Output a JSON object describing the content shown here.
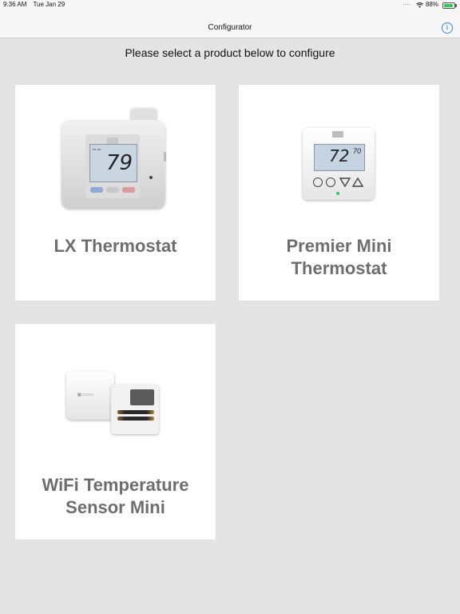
{
  "status_bar": {
    "time": "9:36 AM",
    "date": "Tue Jan 29",
    "battery": "88%",
    "battery_level": 0.88,
    "icons": [
      "signal-dots-icon",
      "wifi-icon",
      "battery-icon"
    ]
  },
  "nav": {
    "title": "Configurator",
    "info_icon": "info-icon"
  },
  "instruction": "Please select a product below to configure",
  "products": [
    {
      "label_line1": "LX Thermostat",
      "label_line2": "",
      "image": "lx-thermostat-image",
      "screen_temp": "79"
    },
    {
      "label_line1": "Premier Mini",
      "label_line2": "Thermostat",
      "image": "premier-mini-thermostat-image",
      "screen_temp": "72",
      "set_temp": "70"
    },
    {
      "label_line1": "WiFi Temperature",
      "label_line2": "Sensor Mini",
      "image": "wifi-temperature-sensor-image"
    }
  ],
  "colors": {
    "background": "#e4e4e4",
    "card": "#ffffff",
    "label": "#6e6e6e",
    "accent": "#3b82e0"
  }
}
